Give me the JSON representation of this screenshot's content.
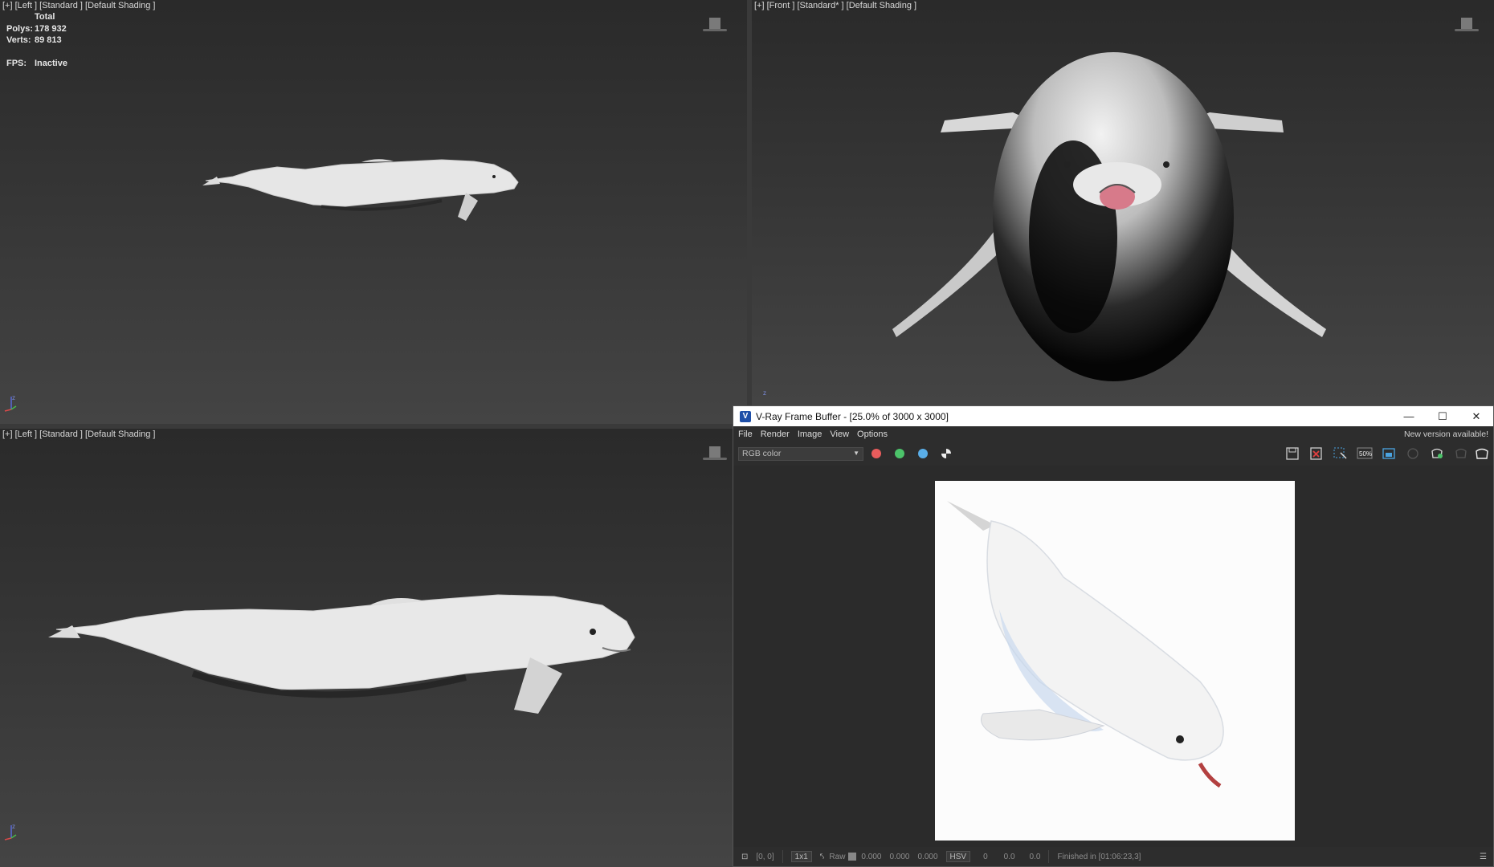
{
  "viewports": {
    "top_left": {
      "label": "[+] [Left ] [Standard ] [Default Shading ]"
    },
    "top_right": {
      "label": "[+] [Front ] [Standard* ] [Default Shading ]"
    },
    "bottom_left": {
      "label": "[+] [Left ] [Standard ] [Default Shading ]"
    }
  },
  "stats": {
    "total_label": "Total",
    "polys_key": "Polys:",
    "polys_val": "178 932",
    "verts_key": "Verts:",
    "verts_val": "89 813",
    "fps_key": "FPS:",
    "fps_val": "Inactive"
  },
  "axis": {
    "z": "z"
  },
  "vfb": {
    "title": "V-Ray Frame Buffer - [25.0% of 3000 x 3000]",
    "logo": "V",
    "menu": [
      "File",
      "Render",
      "Image",
      "View",
      "Options"
    ],
    "new_version": "New version available!",
    "channel": "RGB color",
    "zoom_label": "50%",
    "channel_colors": {
      "red": "#e85c5c",
      "green": "#4cc36a",
      "blue": "#5aaee8"
    },
    "status": {
      "coords": "[0, 0]",
      "ratio": "1x1",
      "raw": "Raw",
      "v1": "0.000",
      "v2": "0.000",
      "v3": "0.000",
      "mode": "HSV",
      "h": "0",
      "s": "0.0",
      "v": "0.0",
      "finished": "Finished in [01:06:23,3]"
    }
  }
}
